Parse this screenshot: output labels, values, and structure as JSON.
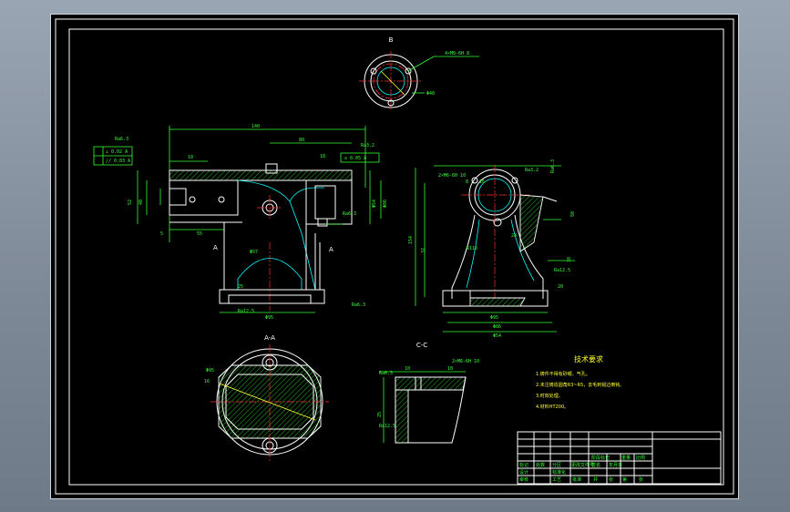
{
  "views": {
    "top_label": "B",
    "section_aa": "A-A",
    "section_cc": "C-C",
    "arrow_a": "A"
  },
  "dims": {
    "d140": "140",
    "d80": "80",
    "d10": "10",
    "d5": "5",
    "d55": "55",
    "d8": "8",
    "d18": "18",
    "d154": "154",
    "d37": "37",
    "d25": "25",
    "d52": "52",
    "d16": "16",
    "d40": "40",
    "phi110": "R110",
    "phi40": "Φ40",
    "phi95": "Φ95",
    "phi86": "Φ86",
    "phi54": "Φ54",
    "phi57": "Φ57",
    "m6": "4×M8-6H 8",
    "m6b": "2×M6-6H 10",
    "r28": "28",
    "roughness": "Ra6.3",
    "roughness2": "Ra3.2",
    "roughness3": "Ra12.5",
    "tolerance1": "⊥ 0.02 A",
    "tolerance2": "// 0.03 A",
    "tolerance3": "◎ 0.05 A",
    "p38": "38",
    "p50": "50",
    "p20": "20"
  },
  "tech": {
    "title": "技术要求",
    "line1": "1.铸件不得有砂眼、气孔。",
    "line2": "2.未注铸造圆角R3~R5，去毛刺锐边倒钝。",
    "line3": "3.时效处理。",
    "line4": "4.材料HT200。"
  },
  "title_block": {
    "c1": "标记",
    "c2": "处数",
    "c3": "分区",
    "c4": "更改文件号",
    "c5": "签名",
    "c6": "年月日",
    "c7": "设计",
    "c8": "标准化",
    "c9": "阶段标记",
    "c10": "重量",
    "c11": "比例",
    "c12": "审核",
    "c13": "工艺",
    "c14": "批准",
    "c15": "共",
    "c16": "张",
    "c17": "第",
    "c18": "张"
  }
}
